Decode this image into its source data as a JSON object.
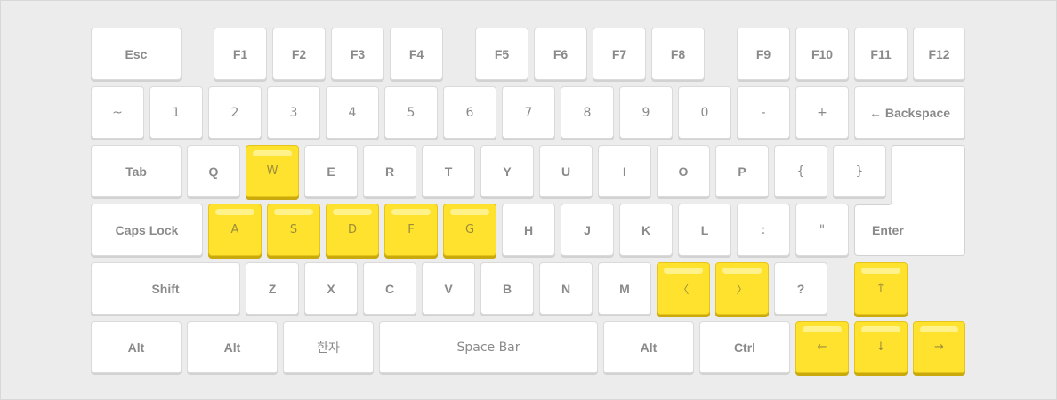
{
  "keyboard": {
    "row1": [
      "Esc",
      "F1",
      "F2",
      "F3",
      "F4",
      "F5",
      "F6",
      "F7",
      "F8",
      "F9",
      "F10",
      "F11",
      "F12"
    ],
    "row2": [
      "~",
      "1",
      "2",
      "3",
      "4",
      "5",
      "6",
      "7",
      "8",
      "9",
      "0",
      "-",
      "+",
      "← Backspace"
    ],
    "row3": [
      "Tab",
      "Q",
      "W",
      "E",
      "R",
      "T",
      "Y",
      "U",
      "I",
      "O",
      "P",
      "{",
      "}"
    ],
    "row4": [
      "Caps Lock",
      "A",
      "S",
      "D",
      "F",
      "G",
      "H",
      "J",
      "K",
      "L",
      ":",
      "\"",
      "Enter"
    ],
    "row5": [
      "Shift",
      "Z",
      "X",
      "C",
      "V",
      "B",
      "N",
      "M",
      "〈",
      "〉",
      "?",
      "↑"
    ],
    "row6": [
      "Alt",
      "Alt",
      "한자",
      "Space Bar",
      "Alt",
      "Ctrl",
      "←",
      "↓",
      "→"
    ]
  },
  "highlighted_keys": [
    "W",
    "A",
    "S",
    "D",
    "F",
    "G",
    "〈",
    "〉",
    "↑",
    "←",
    "↓",
    "→"
  ],
  "colors": {
    "background": "#ececec",
    "key": "#ffffff",
    "highlight": "#ffe22e"
  }
}
